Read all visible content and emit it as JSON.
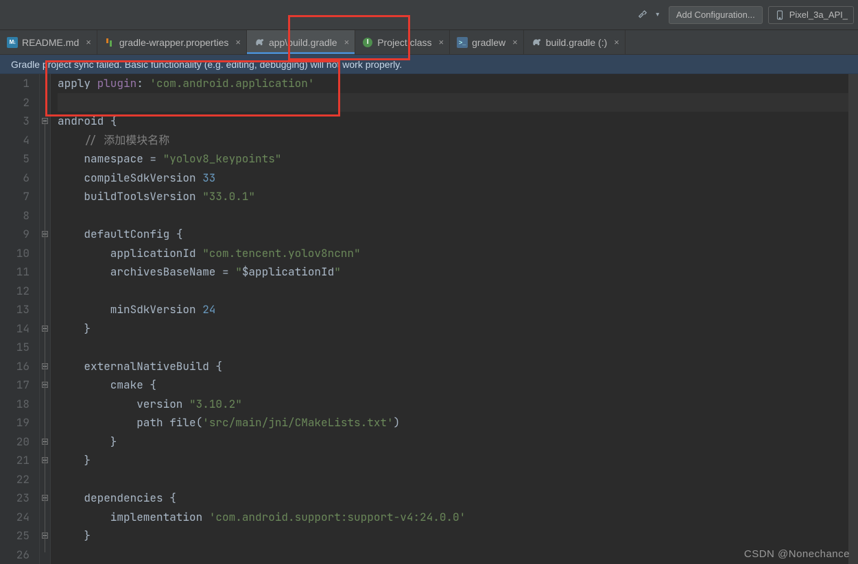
{
  "toolbar": {
    "config_label": "Add Configuration...",
    "device_label": "Pixel_3a_API_"
  },
  "tabs": [
    {
      "label": "README.md",
      "kind": "md"
    },
    {
      "label": "gradle-wrapper.properties",
      "kind": "gprops"
    },
    {
      "label": "app\\build.gradle",
      "kind": "gradle",
      "active": true
    },
    {
      "label": "Project.class",
      "kind": "class"
    },
    {
      "label": "gradlew",
      "kind": "sh"
    },
    {
      "label": "build.gradle (:)",
      "kind": "gradle"
    }
  ],
  "banner": {
    "text": "Gradle project sync failed. Basic functionality (e.g. editing, debugging) will not work properly."
  },
  "code": {
    "lines": [
      [
        {
          "t": "apply ",
          "c": "fn"
        },
        {
          "t": "plugin",
          "c": "id"
        },
        {
          "t": ": ",
          "c": "pun"
        },
        {
          "t": "'com.android.application'",
          "c": "str"
        }
      ],
      [],
      [
        {
          "t": "android ",
          "c": "fn"
        },
        {
          "t": "{",
          "c": "pun"
        }
      ],
      [
        {
          "t": "    ",
          "c": "pun"
        },
        {
          "t": "// 添加模块名称",
          "c": "cmt"
        }
      ],
      [
        {
          "t": "    namespace ",
          "c": "fn"
        },
        {
          "t": "= ",
          "c": "pun"
        },
        {
          "t": "\"yolov8_keypoints\"",
          "c": "str"
        }
      ],
      [
        {
          "t": "    compileSdkVersion ",
          "c": "fn"
        },
        {
          "t": "33",
          "c": "num"
        }
      ],
      [
        {
          "t": "    buildToolsVersion ",
          "c": "fn"
        },
        {
          "t": "\"33.0.1\"",
          "c": "str"
        }
      ],
      [],
      [
        {
          "t": "    defaultConfig ",
          "c": "fn"
        },
        {
          "t": "{",
          "c": "pun"
        }
      ],
      [
        {
          "t": "        applicationId ",
          "c": "fn"
        },
        {
          "t": "\"com.tencent.yolov8ncnn\"",
          "c": "str"
        }
      ],
      [
        {
          "t": "        archivesBaseName ",
          "c": "fn"
        },
        {
          "t": "= ",
          "c": "pun"
        },
        {
          "t": "\"",
          "c": "str"
        },
        {
          "t": "$applicationId",
          "c": "fn"
        },
        {
          "t": "\"",
          "c": "str"
        }
      ],
      [],
      [
        {
          "t": "        minSdkVersion ",
          "c": "fn"
        },
        {
          "t": "24",
          "c": "num"
        }
      ],
      [
        {
          "t": "    }",
          "c": "pun"
        }
      ],
      [],
      [
        {
          "t": "    externalNativeBuild ",
          "c": "fn"
        },
        {
          "t": "{",
          "c": "pun"
        }
      ],
      [
        {
          "t": "        cmake ",
          "c": "fn"
        },
        {
          "t": "{",
          "c": "pun"
        }
      ],
      [
        {
          "t": "            version ",
          "c": "fn"
        },
        {
          "t": "\"3.10.2\"",
          "c": "str"
        }
      ],
      [
        {
          "t": "            path ",
          "c": "fn"
        },
        {
          "t": "file(",
          "c": "fn"
        },
        {
          "t": "'src/main/jni/CMakeLists.txt'",
          "c": "str"
        },
        {
          "t": ")",
          "c": "fn"
        }
      ],
      [
        {
          "t": "        }",
          "c": "pun"
        }
      ],
      [
        {
          "t": "    }",
          "c": "pun"
        }
      ],
      [],
      [
        {
          "t": "    dependencies ",
          "c": "fn"
        },
        {
          "t": "{",
          "c": "pun"
        }
      ],
      [
        {
          "t": "        implementation ",
          "c": "fn"
        },
        {
          "t": "'com.android.support:support-v4:24.0.0'",
          "c": "str"
        }
      ],
      [
        {
          "t": "    }",
          "c": "pun"
        }
      ],
      []
    ]
  },
  "watermark": "CSDN @Nonechance"
}
